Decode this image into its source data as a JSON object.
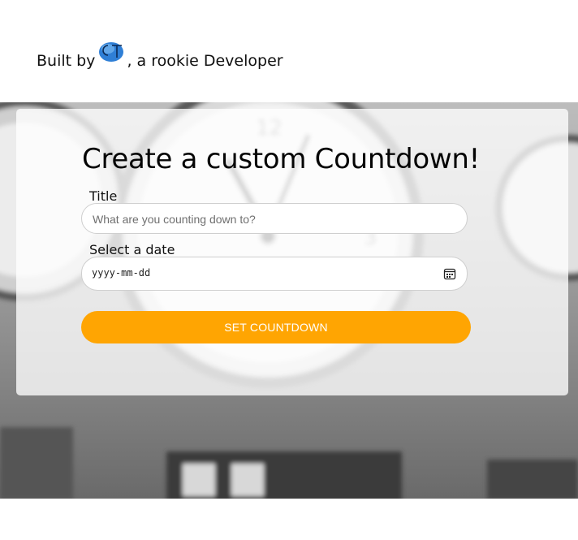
{
  "header": {
    "byline_prefix": "Built by",
    "logo_text": "CT",
    "byline_suffix": ", a rookie Developer"
  },
  "form": {
    "heading": "Create a custom Countdown!",
    "title_label": "Title",
    "title_placeholder": "What are you counting down to?",
    "date_label": "Select a date",
    "date_placeholder": "yyyy-mm-dd",
    "submit_label": "SET COUNTDOWN"
  },
  "colors": {
    "accent": "#ffa502",
    "logo_blue": "#2f7fd6"
  }
}
